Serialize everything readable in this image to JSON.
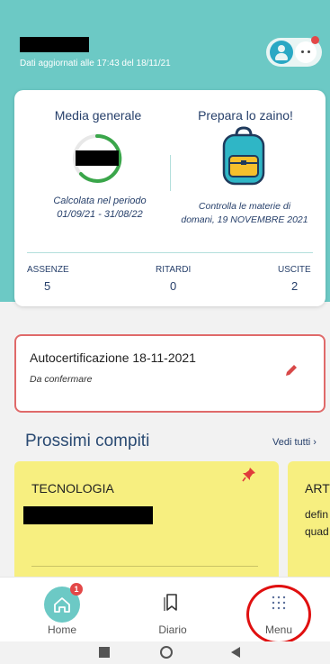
{
  "header": {
    "updated_text": "Dati aggiornati alle 17:43 del 18/11/21"
  },
  "summary": {
    "average_title": "Media generale",
    "period_text": "Calcolata nel periodo",
    "period_range": "01/09/21 - 31/08/22",
    "backpack_title": "Prepara lo zaino!",
    "backpack_text": "Controlla le materie di",
    "backpack_date": "domani, 19 NOVEMBRE 2021",
    "stats": [
      {
        "label": "ASSENZE",
        "value": "5"
      },
      {
        "label": "RITARDI",
        "value": "0"
      },
      {
        "label": "USCITE",
        "value": "2"
      }
    ]
  },
  "certificate": {
    "title": "Autocertificazione 18-11-2021",
    "status": "Da confermare"
  },
  "homework": {
    "title": "Prossimi compiti",
    "see_all": "Vedi tutti ›",
    "cards": [
      {
        "subject": "TECNOLOGIA"
      },
      {
        "subject": "ART",
        "text_line1": "defin",
        "text_line2": "quad"
      }
    ]
  },
  "nav": {
    "home_label": "Home",
    "home_badge": "1",
    "diary_label": "Diario",
    "menu_label": "Menu"
  },
  "colors": {
    "accent": "#6cc9c5",
    "note": "#f7ef80",
    "alert": "#e06a6a"
  }
}
